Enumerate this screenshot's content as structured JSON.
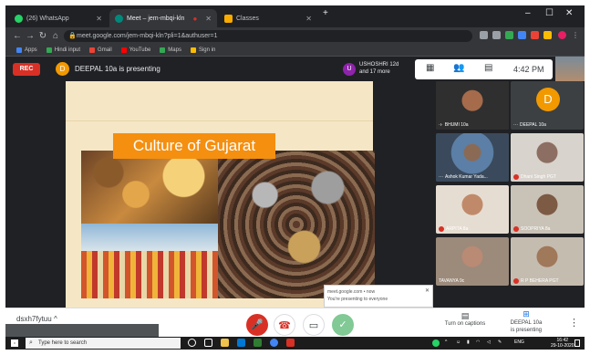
{
  "browser": {
    "tabs": [
      {
        "label": "(26) WhatsApp",
        "icon": "whatsapp-icon",
        "color": "#25d366"
      },
      {
        "label": "Meet – jem-mbqi-kln",
        "icon": "meet-icon",
        "color": "#00897b"
      },
      {
        "label": "Classes",
        "icon": "classroom-icon",
        "color": "#f9ab00"
      }
    ],
    "url": "meet.google.com/jem-mbqi-kln?pli=1&authuser=1",
    "bookmarks": [
      {
        "label": "Apps",
        "color": "#4285f4"
      },
      {
        "label": "Hindi input",
        "color": "#34a853"
      },
      {
        "label": "Gmail",
        "color": "#ea4335"
      },
      {
        "label": "YouTube",
        "color": "#ff0000"
      },
      {
        "label": "Maps",
        "color": "#34a853"
      },
      {
        "label": "Sign in",
        "color": "#fbbc04"
      }
    ]
  },
  "meet": {
    "rec_label": "REC",
    "presenter_initial": "D",
    "presenting_text": "DEEPAL 10a is presenting",
    "other_user_initial": "U",
    "other_user_line1": "USHOSHRI 12d",
    "other_user_line2": "and 17 more",
    "time": "4:42 PM",
    "slide_title": "Culture of Gujarat",
    "notification_line1": "meet.google.com • now",
    "notification_line2": "You're presenting to everyone",
    "participants": [
      {
        "name": "BHUMI 10a",
        "has_mic_dot": false,
        "tone": "#a56b4b"
      },
      {
        "name": "DEEPAL 10a",
        "has_mic_dot": false,
        "avatar": "D"
      },
      {
        "name": "Ashok Kumar Yada...",
        "has_mic_dot": false,
        "tone": "#5b7fa6"
      },
      {
        "name": "Dhani Singh PGT",
        "has_mic_dot": true,
        "tone": "#8d6e63"
      },
      {
        "name": "ARPITA 8a",
        "has_mic_dot": true,
        "tone": "#c08a6a"
      },
      {
        "name": "SOOPRIYA 8a",
        "has_mic_dot": true,
        "tone": "#7d5a44"
      },
      {
        "name": "TAVANYA 9c",
        "has_mic_dot": false,
        "tone": "#b98a74"
      },
      {
        "name": "R P BEHERA PGT",
        "has_mic_dot": true,
        "tone": "#a0785a"
      }
    ],
    "meeting_code": "dsxh7fytuu",
    "caption_label": "Turn on captions",
    "presenting_btn_line1": "DEEPAL 10a",
    "presenting_btn_line2": "is presenting"
  },
  "taskbar": {
    "search_placeholder": "Type here to search",
    "lang": "ENG",
    "clock_time": "16:42",
    "clock_date": "29-10-2020"
  }
}
